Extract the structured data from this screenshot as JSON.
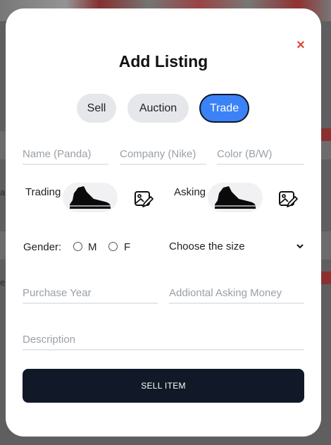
{
  "modal": {
    "title": "Add Listing",
    "close_glyph": "×",
    "tabs": [
      {
        "label": "Sell",
        "active": false
      },
      {
        "label": "Auction",
        "active": false
      },
      {
        "label": "Trade",
        "active": true
      }
    ],
    "fields": {
      "name_placeholder": "Name (Panda)",
      "company_placeholder": "Company (Nike)",
      "color_placeholder": "Color (B/W)",
      "purchase_year_placeholder": "Purchase Year",
      "asking_money_placeholder": "Addiontal Asking Money",
      "description_placeholder": "Description"
    },
    "trading_label": "Trading",
    "asking_label": "Asking",
    "gender": {
      "label": "Gender:",
      "options": [
        "M",
        "F"
      ]
    },
    "size_select": "Choose the size",
    "submit_label": "SELL ITEM",
    "icons": {
      "close": "close-icon",
      "shoe": "sneaker-icon",
      "edit_image": "image-edit-icon",
      "select": "chevron-down-icon"
    },
    "colors": {
      "active_tab": "#3b82f6",
      "close": "#e0443a",
      "button": "#111827"
    }
  },
  "background": {
    "fragments": [
      "a",
      "el"
    ]
  }
}
